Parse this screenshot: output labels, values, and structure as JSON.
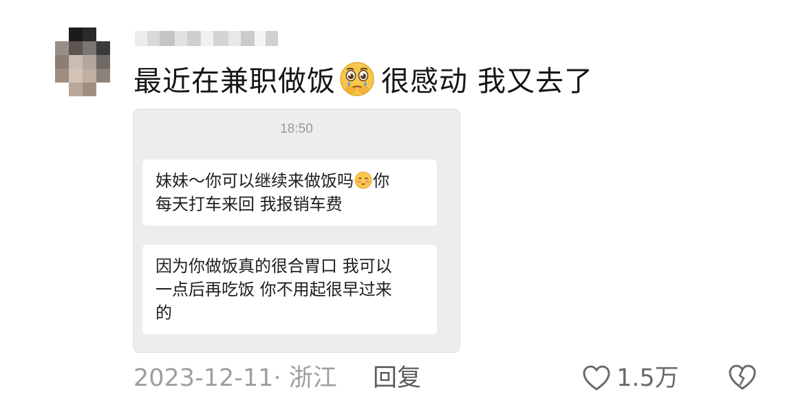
{
  "comment": {
    "text_before_emoji": "最近在兼职做饭",
    "emoji": "pleading-face-icon",
    "text_after_emoji": "很感动 我又去了"
  },
  "chat": {
    "time": "18:50",
    "bubble1_line1_a": "妹妹～你可以继续来做饭吗",
    "bubble1_line1_b": "你",
    "bubble1_line2": "每天打车来回 我报销车费",
    "bubble2_line1": "因为你做饭真的很合胃口 我可以",
    "bubble2_line2": "一点后再吃饭 你不用起很早过来",
    "bubble2_line3": "的"
  },
  "footer": {
    "date": "2023-12-11",
    "separator": "·",
    "location": "浙江",
    "reply_label": "回复",
    "like_count": "1.5万"
  },
  "colors": {
    "meta_gray": "#9e9e9e",
    "chat_bg": "#ededed",
    "bubble_bg": "#ffffff"
  }
}
